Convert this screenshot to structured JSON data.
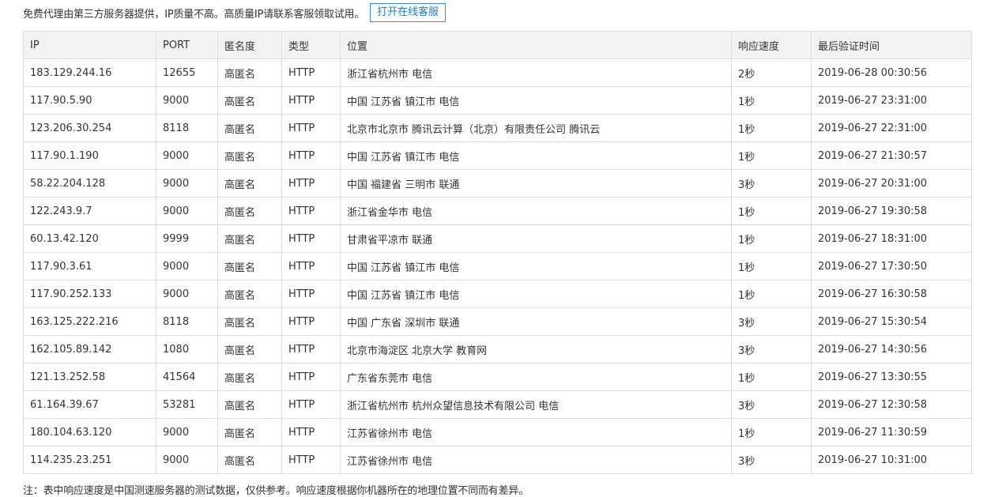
{
  "notice": {
    "text": "免费代理由第三方服务器提供，IP质量不高。高质量IP请联系客服领取试用。",
    "button_label": "打开在线客服"
  },
  "table": {
    "columns": [
      "IP",
      "PORT",
      "匿名度",
      "类型",
      "位置",
      "响应速度",
      "最后验证时间"
    ],
    "rows": [
      [
        "183.129.244.16",
        "12655",
        "高匿名",
        "HTTP",
        "浙江省杭州市 电信",
        "2秒",
        "2019-06-28 00:30:56"
      ],
      [
        "117.90.5.90",
        "9000",
        "高匿名",
        "HTTP",
        "中国 江苏省 镇江市 电信",
        "1秒",
        "2019-06-27 23:31:00"
      ],
      [
        "123.206.30.254",
        "8118",
        "高匿名",
        "HTTP",
        "北京市北京市 腾讯云计算（北京）有限责任公司 腾讯云",
        "1秒",
        "2019-06-27 22:31:00"
      ],
      [
        "117.90.1.190",
        "9000",
        "高匿名",
        "HTTP",
        "中国 江苏省 镇江市 电信",
        "1秒",
        "2019-06-27 21:30:57"
      ],
      [
        "58.22.204.128",
        "9000",
        "高匿名",
        "HTTP",
        "中国 福建省 三明市 联通",
        "3秒",
        "2019-06-27 20:31:00"
      ],
      [
        "122.243.9.7",
        "9000",
        "高匿名",
        "HTTP",
        "浙江省金华市 电信",
        "1秒",
        "2019-06-27 19:30:58"
      ],
      [
        "60.13.42.120",
        "9999",
        "高匿名",
        "HTTP",
        "甘肃省平凉市 联通",
        "1秒",
        "2019-06-27 18:31:00"
      ],
      [
        "117.90.3.61",
        "9000",
        "高匿名",
        "HTTP",
        "中国 江苏省 镇江市 电信",
        "1秒",
        "2019-06-27 17:30:50"
      ],
      [
        "117.90.252.133",
        "9000",
        "高匿名",
        "HTTP",
        "中国 江苏省 镇江市 电信",
        "1秒",
        "2019-06-27 16:30:58"
      ],
      [
        "163.125.222.216",
        "8118",
        "高匿名",
        "HTTP",
        "中国 广东省 深圳市 联通",
        "3秒",
        "2019-06-27 15:30:54"
      ],
      [
        "162.105.89.142",
        "1080",
        "高匿名",
        "HTTP",
        "北京市海淀区 北京大学 教育网",
        "3秒",
        "2019-06-27 14:30:56"
      ],
      [
        "121.13.252.58",
        "41564",
        "高匿名",
        "HTTP",
        "广东省东莞市 电信",
        "1秒",
        "2019-06-27 13:30:55"
      ],
      [
        "61.164.39.67",
        "53281",
        "高匿名",
        "HTTP",
        "浙江省杭州市 杭州众望信息技术有限公司 电信",
        "3秒",
        "2019-06-27 12:30:58"
      ],
      [
        "180.104.63.120",
        "9000",
        "高匿名",
        "HTTP",
        "江苏省徐州市 电信",
        "1秒",
        "2019-06-27 11:30:59"
      ],
      [
        "114.235.23.251",
        "9000",
        "高匿名",
        "HTTP",
        "江苏省徐州市 电信",
        "3秒",
        "2019-06-27 10:31:00"
      ]
    ]
  },
  "footnote": "注：表中响应速度是中国测速服务器的测试数据，仅供参考。响应速度根据你机器所在的地理位置不同而有差异。",
  "colors": {
    "header_bg": "#f2f2f2",
    "border": "#dedede",
    "button_border": "#3a94c9",
    "button_text": "#1a7fc1"
  }
}
